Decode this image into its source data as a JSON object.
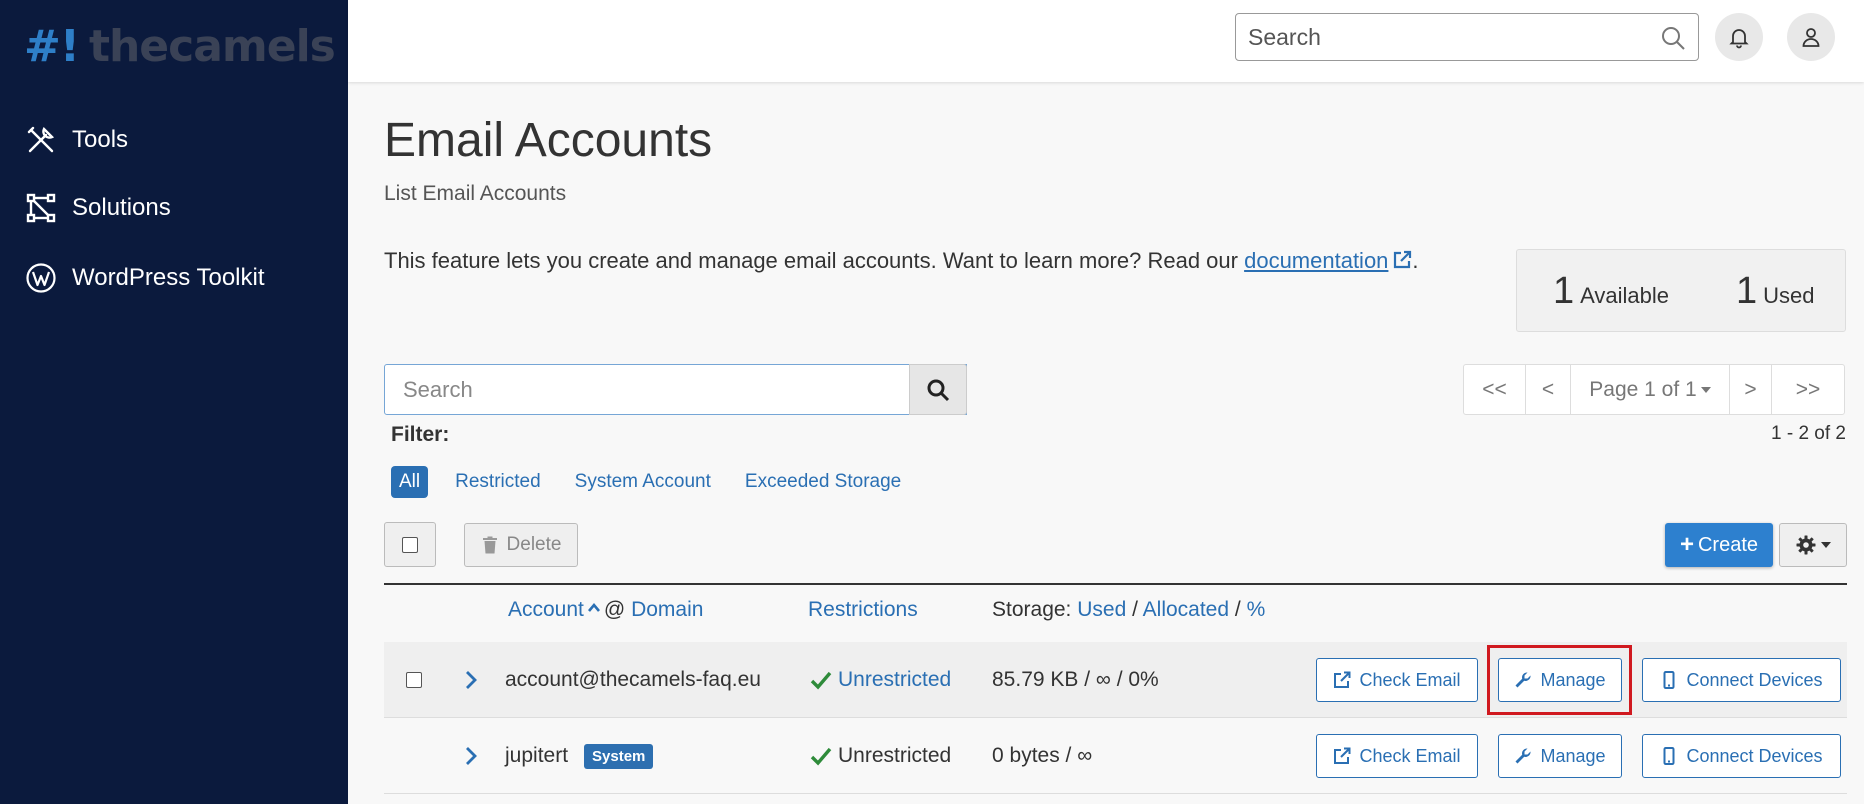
{
  "brand": {
    "hash": "#!",
    "name": "thecamels"
  },
  "sidebar": {
    "items": [
      {
        "label": "Tools",
        "icon": "tools-icon"
      },
      {
        "label": "Solutions",
        "icon": "solutions-icon"
      },
      {
        "label": "WordPress Toolkit",
        "icon": "wordpress-icon"
      }
    ]
  },
  "header": {
    "search_placeholder": "Search"
  },
  "page": {
    "title": "Email Accounts",
    "subtitle": "List Email Accounts",
    "description": "This feature lets you create and manage email accounts. Want to learn more? Read our ",
    "doc_link": "documentation",
    "description_end": "."
  },
  "stats": {
    "available_count": "1",
    "available_label": "Available",
    "used_count": "1",
    "used_label": "Used"
  },
  "list": {
    "search_placeholder": "Search",
    "pager": {
      "first": "<<",
      "prev": "<",
      "page": "Page 1 of 1",
      "next": ">",
      "last": ">>"
    },
    "range": "1 - 2 of 2",
    "filter_label": "Filter:",
    "filters": [
      "All",
      "Restricted",
      "System Account",
      "Exceeded Storage"
    ],
    "active_filter": "All",
    "delete_label": "Delete",
    "create_label": "Create"
  },
  "table": {
    "headers": {
      "account": "Account",
      "at": "@",
      "domain": "Domain",
      "restrictions": "Restrictions",
      "storage": "Storage:",
      "used": "Used",
      "sep1": "/",
      "allocated": "Allocated",
      "sep2": "/",
      "pct": "%"
    },
    "rows": [
      {
        "account": "account@thecamels-faq.eu",
        "badge": "",
        "restriction": "Unrestricted",
        "storage": "85.79 KB / ∞ / 0%"
      },
      {
        "account": "jupitert",
        "badge": "System",
        "restriction": "Unrestricted",
        "storage": "0 bytes / ∞"
      }
    ],
    "actions": {
      "check_email": "Check Email",
      "manage": "Manage",
      "connect_devices": "Connect Devices"
    }
  },
  "colors": {
    "sidebar_bg": "#0b1a3d",
    "accent": "#2a6fb3",
    "success": "#2e8b3a",
    "highlight": "#d0191f"
  }
}
